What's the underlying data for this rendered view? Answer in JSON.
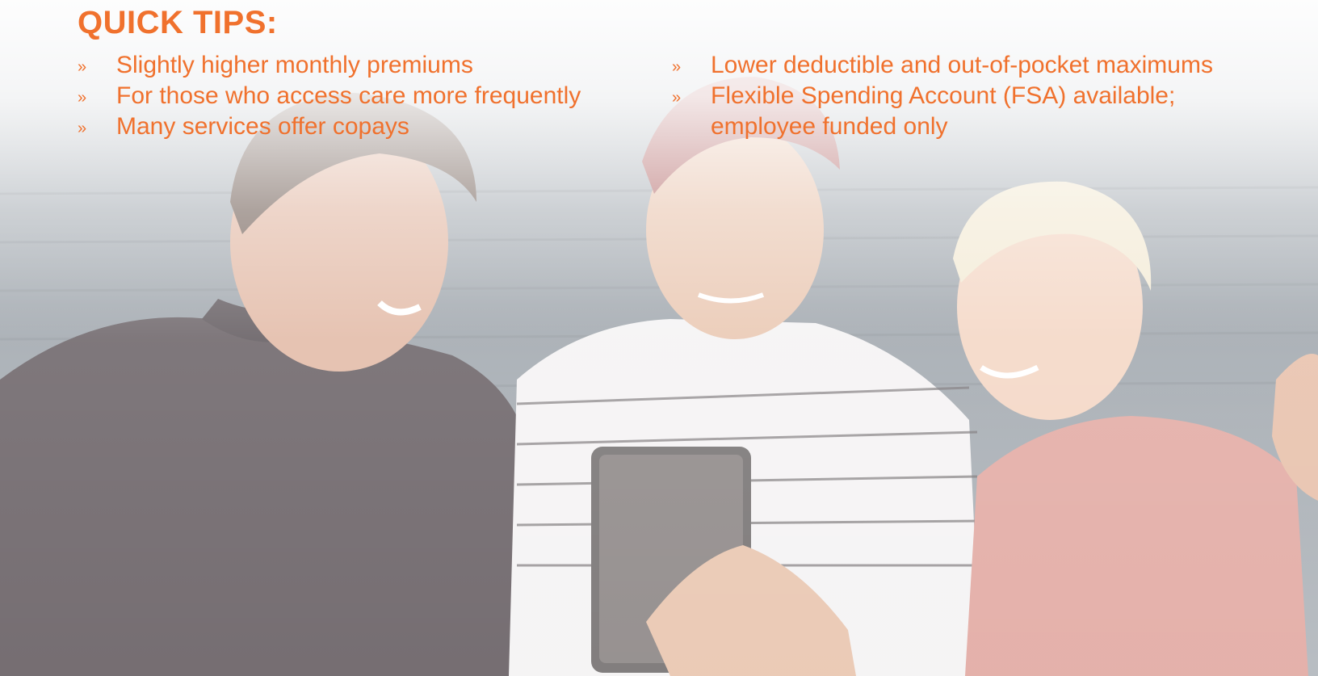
{
  "colors": {
    "accent": "#F0712D",
    "wall": "#8E969E",
    "wall_dark": "#5F6770"
  },
  "heading": "QUICK TIPS:",
  "bullet_glyph": "»",
  "tips_left": [
    "Slightly higher monthly premiums",
    "For those who access care more frequently",
    "Many services offer copays"
  ],
  "tips_right": [
    "Lower deductible and out-of-pocket maximums",
    "Flexible Spending Account (FSA) available; employee funded only"
  ]
}
